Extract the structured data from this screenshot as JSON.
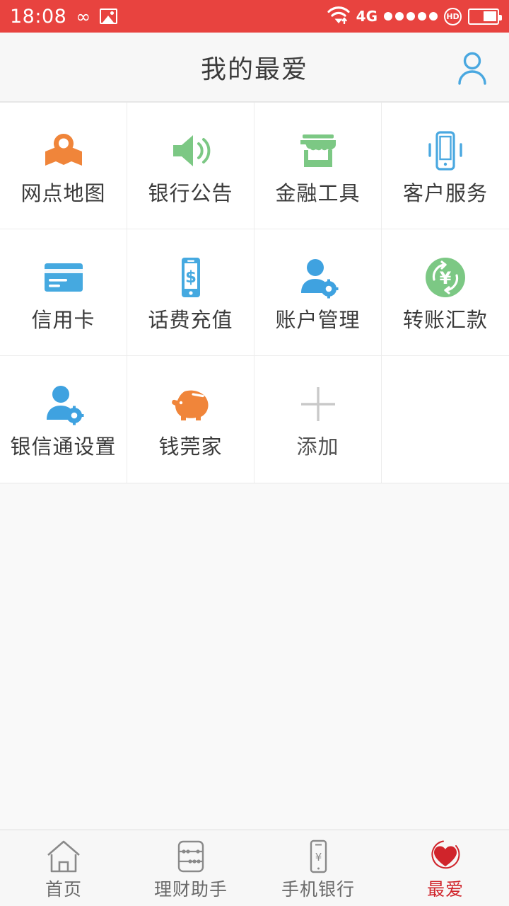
{
  "statusbar": {
    "time": "18:08",
    "infinity_icon": "∞",
    "screenshot_icon": "image-icon",
    "network_label": "4G",
    "signal_dots": 5,
    "hd_label": "HD",
    "wifi_icon": "wifi-icon",
    "battery_icon": "battery-icon",
    "background_color": "#e8433f"
  },
  "header": {
    "title": "我的最爱",
    "avatar_icon": "user-avatar-icon",
    "avatar_color": "#4aa8e0"
  },
  "grid": {
    "items": [
      {
        "label": "网点地图",
        "icon": "map-pin-icon",
        "color": "#f0853a"
      },
      {
        "label": "银行公告",
        "icon": "speaker-icon",
        "color": "#7cc884"
      },
      {
        "label": "金融工具",
        "icon": "store-icon",
        "color": "#7cc884"
      },
      {
        "label": "客户服务",
        "icon": "vibrating-phone-icon",
        "color": "#4aa8e0"
      },
      {
        "label": "信用卡",
        "icon": "credit-card-icon",
        "color": "#45a9e0"
      },
      {
        "label": "话费充值",
        "icon": "phone-dollar-icon",
        "color": "#45a9e0"
      },
      {
        "label": "账户管理",
        "icon": "user-gear-icon",
        "color": "#3fa2e0"
      },
      {
        "label": "转账汇款",
        "icon": "transfer-yuan-icon",
        "color": "#7cc884"
      },
      {
        "label": "银信通设置",
        "icon": "user-gear-icon",
        "color": "#3fa2e0"
      },
      {
        "label": "钱莞家",
        "icon": "piggy-bank-icon",
        "color": "#f0853a"
      },
      {
        "label": "添加",
        "icon": "plus-icon",
        "color": "#c9c9c9"
      },
      {
        "label": "",
        "icon": "",
        "color": ""
      }
    ]
  },
  "tabbar": {
    "items": [
      {
        "label": "首页",
        "icon": "home-icon",
        "active": false
      },
      {
        "label": "理财助手",
        "icon": "abacus-icon",
        "active": false
      },
      {
        "label": "手机银行",
        "icon": "phone-yuan-icon",
        "active": false
      },
      {
        "label": "最爱",
        "icon": "heart-icon",
        "active": true
      }
    ],
    "active_color": "#d0242b",
    "inactive_color": "#6a6a6a"
  }
}
